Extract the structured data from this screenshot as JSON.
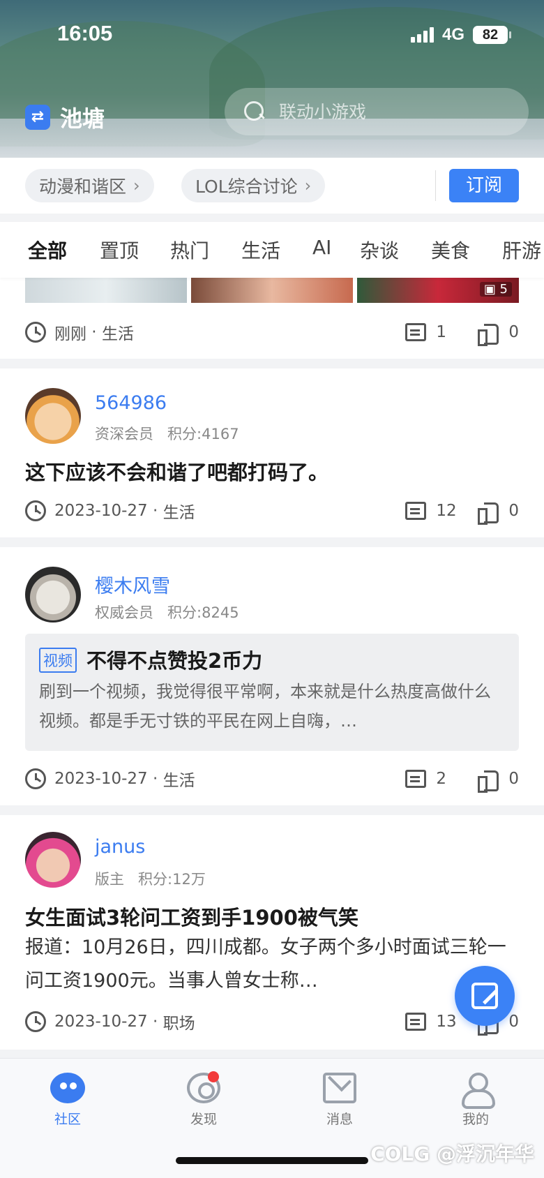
{
  "status_bar": {
    "time": "16:05",
    "network": "4G",
    "battery": "82"
  },
  "header": {
    "title": "池塘",
    "search_placeholder": "联动小游戏"
  },
  "subscriptions": {
    "chips": [
      "动漫和谐区",
      "LOL综合讨论"
    ],
    "subscribe_label": "订阅"
  },
  "tabs": [
    "全部",
    "置顶",
    "热门",
    "生活",
    "AI",
    "杂谈",
    "美食",
    "肝游"
  ],
  "posts": [
    {
      "thumb_count": "5",
      "time": "刚刚",
      "category": "生活",
      "comments": "1",
      "likes": "0"
    },
    {
      "username": "564986",
      "rank": "资深会员",
      "points": "积分:4167",
      "title": "这下应该不会和谐了吧都打码了。",
      "time": "2023-10-27",
      "category": "生活",
      "comments": "12",
      "likes": "0"
    },
    {
      "username": "樱木风雪",
      "rank": "权威会员",
      "points": "积分:8245",
      "video_tag": "视频",
      "video_title": "不得不点赞投2币力",
      "video_desc": "刷到一个视频，我觉得很平常啊，本来就是什么热度高做什么视频。都是手无寸铁的平民在网上自嗨，…",
      "time": "2023-10-27",
      "category": "生活",
      "comments": "2",
      "likes": "0"
    },
    {
      "username": "janus",
      "rank": "版主",
      "points": "积分:12万",
      "title": "女生面试3轮问工资到手1900被气笑",
      "body": "报道：10月26日，四川成都。女子两个多小时面试三轮一问工资1900元。当事人曾女士称…",
      "time": "2023-10-27",
      "category": "职场",
      "comments": "13",
      "likes": "0"
    }
  ],
  "bottom_nav": [
    "社区",
    "发现",
    "消息",
    "我的"
  ],
  "watermark": "COLG @浮沉年华",
  "colors": {
    "accent": "#3b82f6",
    "link": "#3b7cf0",
    "badge": "#f23b3b"
  }
}
